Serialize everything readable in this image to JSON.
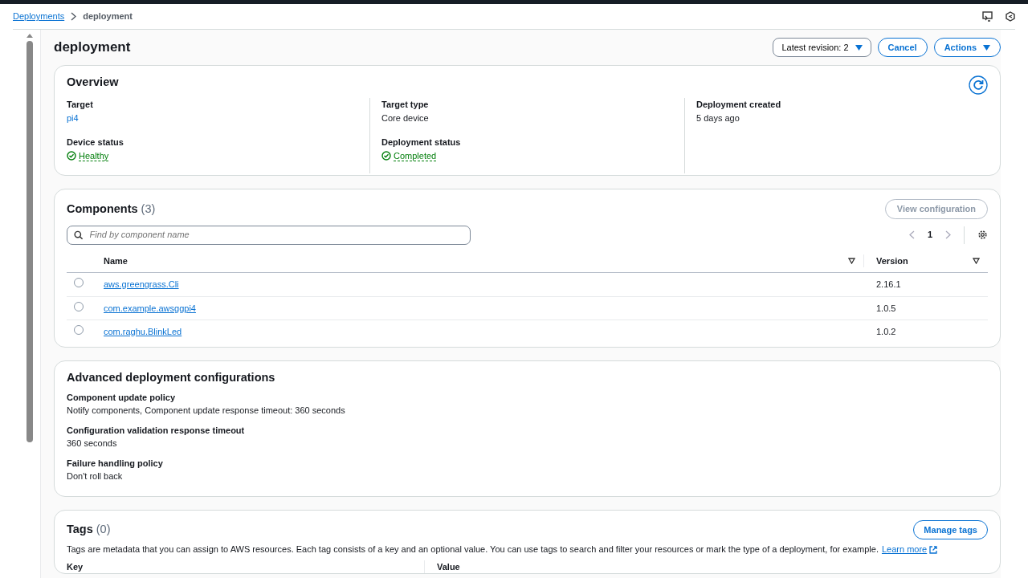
{
  "breadcrumb": [
    {
      "label": "Deployments",
      "kind": "link"
    },
    {
      "label": "deployment",
      "kind": "current"
    }
  ],
  "header": {
    "title": "deployment",
    "revision": "Latest revision: 2",
    "buttons": [
      "Cancel",
      "Actions"
    ]
  },
  "overview": {
    "title": "Overview",
    "columns": [
      [
        {
          "label": "Target",
          "value": "pi4",
          "kind": "link"
        },
        {
          "label": "Device status",
          "value": "Healthy",
          "kind": "status"
        }
      ],
      [
        {
          "label": "Target type",
          "value": "Core device",
          "kind": "text"
        },
        {
          "label": "Deployment status",
          "value": "Completed",
          "kind": "status"
        }
      ],
      [
        {
          "label": "Deployment created",
          "value": "5 days ago",
          "kind": "text"
        }
      ]
    ]
  },
  "components": {
    "title": "Components",
    "count": "(3)",
    "view_button": {
      "label": "View configuration",
      "disabled": true
    },
    "search": {
      "placeholder": "Find by component name"
    },
    "page": "1",
    "columns": [
      "Name",
      "Version"
    ],
    "rows": [
      {
        "name": "aws.greengrass.Cli",
        "version": "2.16.1",
        "selected": false
      },
      {
        "name": "com.example.awsggpi4",
        "version": "1.0.5",
        "selected": false
      },
      {
        "name": "com.raghu.BlinkLed",
        "version": "1.0.2",
        "selected": false
      }
    ]
  },
  "advanced": {
    "title": "Advanced deployment configurations",
    "items": [
      {
        "label": "Component update policy",
        "value": "Notify components, Component update response timeout: 360 seconds"
      },
      {
        "label": "Configuration validation response timeout",
        "value": "360 seconds"
      },
      {
        "label": "Failure handling policy",
        "value": "Don't roll back"
      }
    ]
  },
  "tags": {
    "title": "Tags",
    "count": "(0)",
    "manage_button": "Manage tags",
    "description": "Tags are metadata that you can assign to AWS resources. Each tag consists of a key and an optional value. You can use tags to search and filter your resources or mark the type of a deployment, for example.",
    "learn_more": "Learn more",
    "columns": [
      "Key",
      "Value"
    ]
  }
}
